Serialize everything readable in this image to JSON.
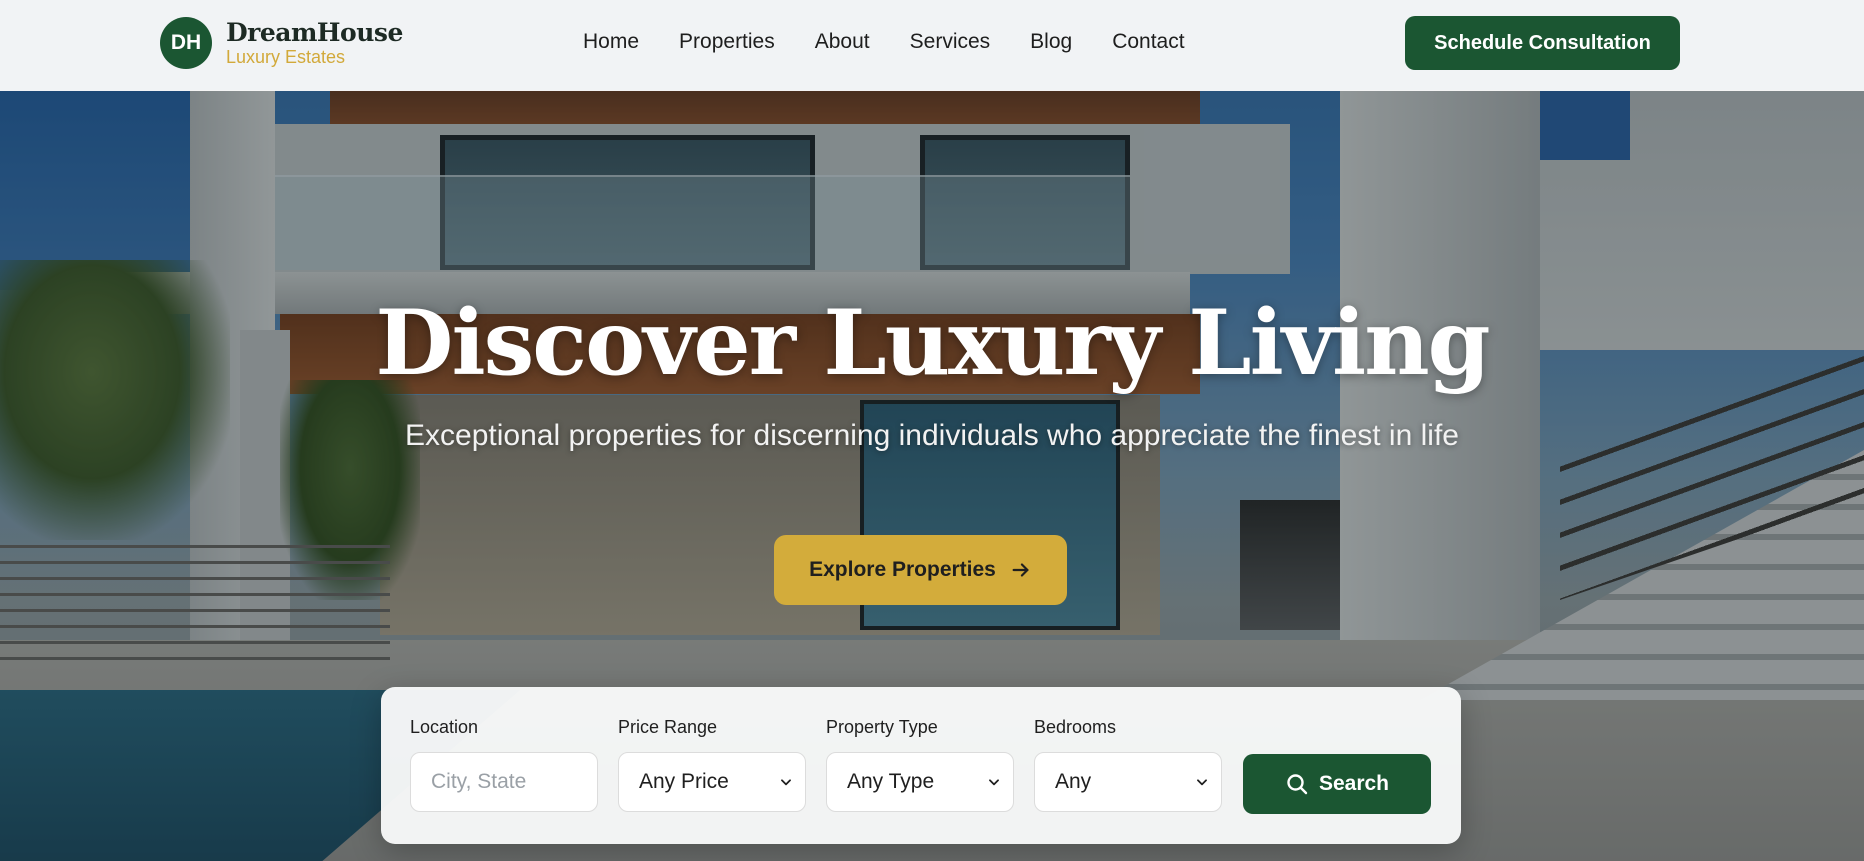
{
  "brand": {
    "initials": "DH",
    "name": "DreamHouse",
    "tagline": "Luxury Estates"
  },
  "nav": {
    "links": [
      "Home",
      "Properties",
      "About",
      "Services",
      "Blog",
      "Contact"
    ],
    "cta_label": "Schedule Consultation"
  },
  "hero": {
    "headline": "Discover Luxury Living",
    "subheadline": "Exceptional properties for discerning individuals who appreciate the finest in life",
    "button_label": "Explore Properties"
  },
  "search": {
    "location": {
      "label": "Location",
      "placeholder": "City, State"
    },
    "price": {
      "label": "Price Range",
      "selected": "Any Price"
    },
    "type": {
      "label": "Property Type",
      "selected": "Any Type"
    },
    "bedrooms": {
      "label": "Bedrooms",
      "selected": "Any"
    },
    "button_label": "Search"
  },
  "colors": {
    "brand_green": "#1b5632",
    "accent_gold": "#d3ac3b"
  },
  "icons": [
    "arrow-right-icon",
    "search-icon",
    "chevron-down-icon"
  ]
}
